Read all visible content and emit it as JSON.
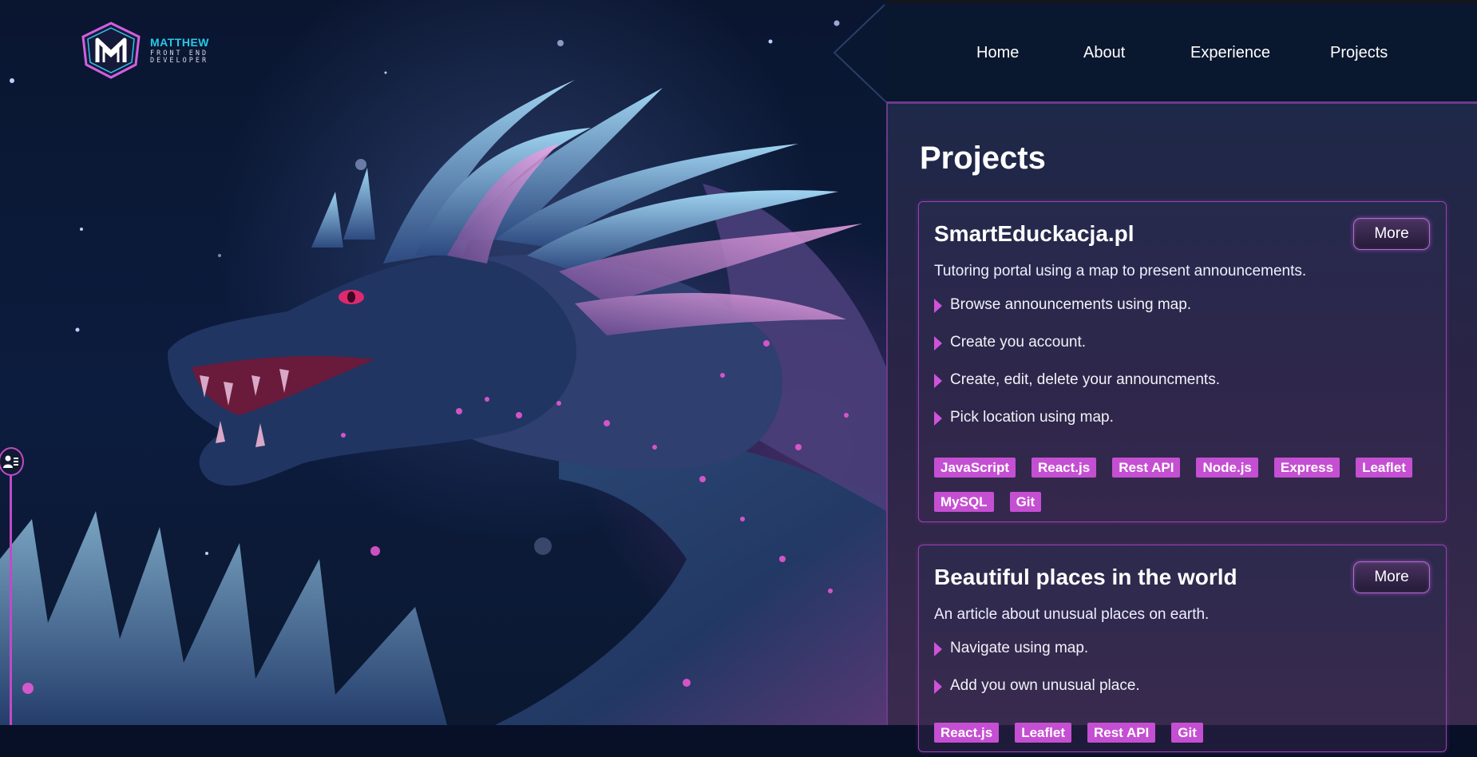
{
  "logo": {
    "name": "MATTHEW",
    "role": "FRONT END DEVELOPER",
    "icon": "m-shield-logo-icon"
  },
  "nav": {
    "items": [
      {
        "label": "Home"
      },
      {
        "label": "About"
      },
      {
        "label": "Experience"
      },
      {
        "label": "Projects"
      }
    ]
  },
  "side": {
    "icon": "contact-card-icon"
  },
  "projects": {
    "title": "Projects",
    "items": [
      {
        "title": "SmartEduckacja.pl",
        "more_label": "More",
        "description": "Tutoring portal using a map to present announcements.",
        "features": [
          "Browse announcements using map.",
          "Create you account.",
          "Create, edit, delete your announcments.",
          "Pick location using map."
        ],
        "tags": [
          "JavaScript",
          "React.js",
          "Rest API",
          "Node.js",
          "Express",
          "Leaflet",
          "MySQL",
          "Git"
        ]
      },
      {
        "title": "Beautiful places in the world",
        "more_label": "More",
        "description": "An article about unusual places on earth.",
        "features": [
          "Navigate using map.",
          "Add you own unusual place."
        ],
        "tags": [
          "React.js",
          "Leaflet",
          "Rest API",
          "Git"
        ]
      }
    ]
  },
  "colors": {
    "accent": "#c54fd2",
    "logo_text": "#27c9ea",
    "background": "#071027"
  }
}
